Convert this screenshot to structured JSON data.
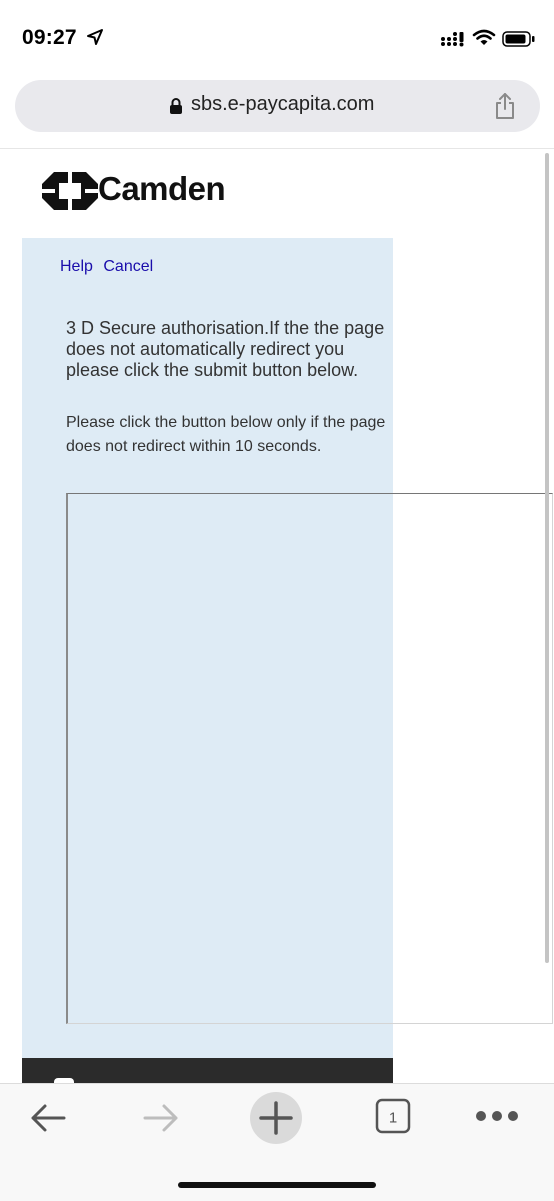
{
  "status_bar": {
    "time": "09:27"
  },
  "browser": {
    "url": "sbs.e-paycapita.com"
  },
  "header": {
    "brand": "Camden"
  },
  "panel": {
    "links": [
      "Help",
      "Cancel"
    ],
    "heading": "3 D Secure authorisation.If the the page does not automatically redirect you please click the submit button below.",
    "note": "Please click the button below only if the page does not redirect within 10 seconds."
  },
  "toolbar": {
    "tab_count": "1"
  },
  "colors": {
    "panel_bg": "#deebf5",
    "link": "#1a0dab",
    "footer_dark": "#2b2b2b"
  }
}
